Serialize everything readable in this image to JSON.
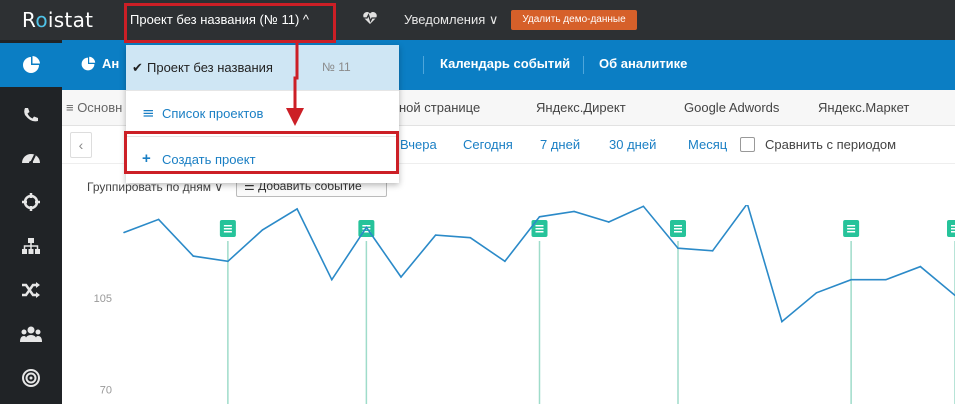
{
  "topbar": {
    "logo_prefix": "R",
    "logo_accent": "o",
    "logo_suffix": "istat",
    "project_selector": "Проект без названия (№ 11) ^",
    "notifications": "Уведомления ∨",
    "delete_demo": "Удалить демо-данные"
  },
  "dropdown": {
    "current_project": "Проект без названия",
    "current_number": "№ 11",
    "list_projects": "Список проектов",
    "create_project": "Создать проект"
  },
  "tabs": [
    {
      "label": "Ан"
    },
    {
      "label": "Календарь событий"
    },
    {
      "label": "Об аналитике"
    }
  ],
  "subnav": [
    "≡ Основн",
    "ной странице",
    "Яндекс.Директ",
    "Google Adwords",
    "Яндекс.Маркет"
  ],
  "datebar": {
    "links": [
      "Вчера",
      "Сегодня",
      "7 дней",
      "30 дней",
      "Месяц"
    ],
    "compare": "Сравнить с периодом"
  },
  "controls": {
    "grouping": "Группировать по дням ∨",
    "add_event": "Добавить событие"
  },
  "colors": {
    "topbar": "#2d3033",
    "sidebar": "#202326",
    "accent": "#0b7ec4",
    "highlight": "#cc1f26",
    "demo_button": "#d6602a",
    "line": "#2b8ac8",
    "marker": "#26c39a"
  },
  "sidebar_icons": [
    "pie-chart-icon",
    "phone-icon",
    "dashboard-icon",
    "crosshair-icon",
    "sitemap-icon",
    "shuffle-icon",
    "users-icon",
    "target-icon"
  ],
  "chart_data": {
    "type": "line",
    "y_ticks": [
      "105",
      "70"
    ],
    "series": [
      {
        "values": [
          130,
          135,
          121,
          119,
          131,
          139,
          112,
          132,
          113,
          129,
          128,
          119,
          136,
          138,
          134,
          140,
          124,
          123,
          141,
          96,
          107,
          112,
          112,
          117,
          106
        ]
      }
    ],
    "event_marker_indices": [
      3,
      7,
      12,
      16,
      21,
      24
    ]
  }
}
